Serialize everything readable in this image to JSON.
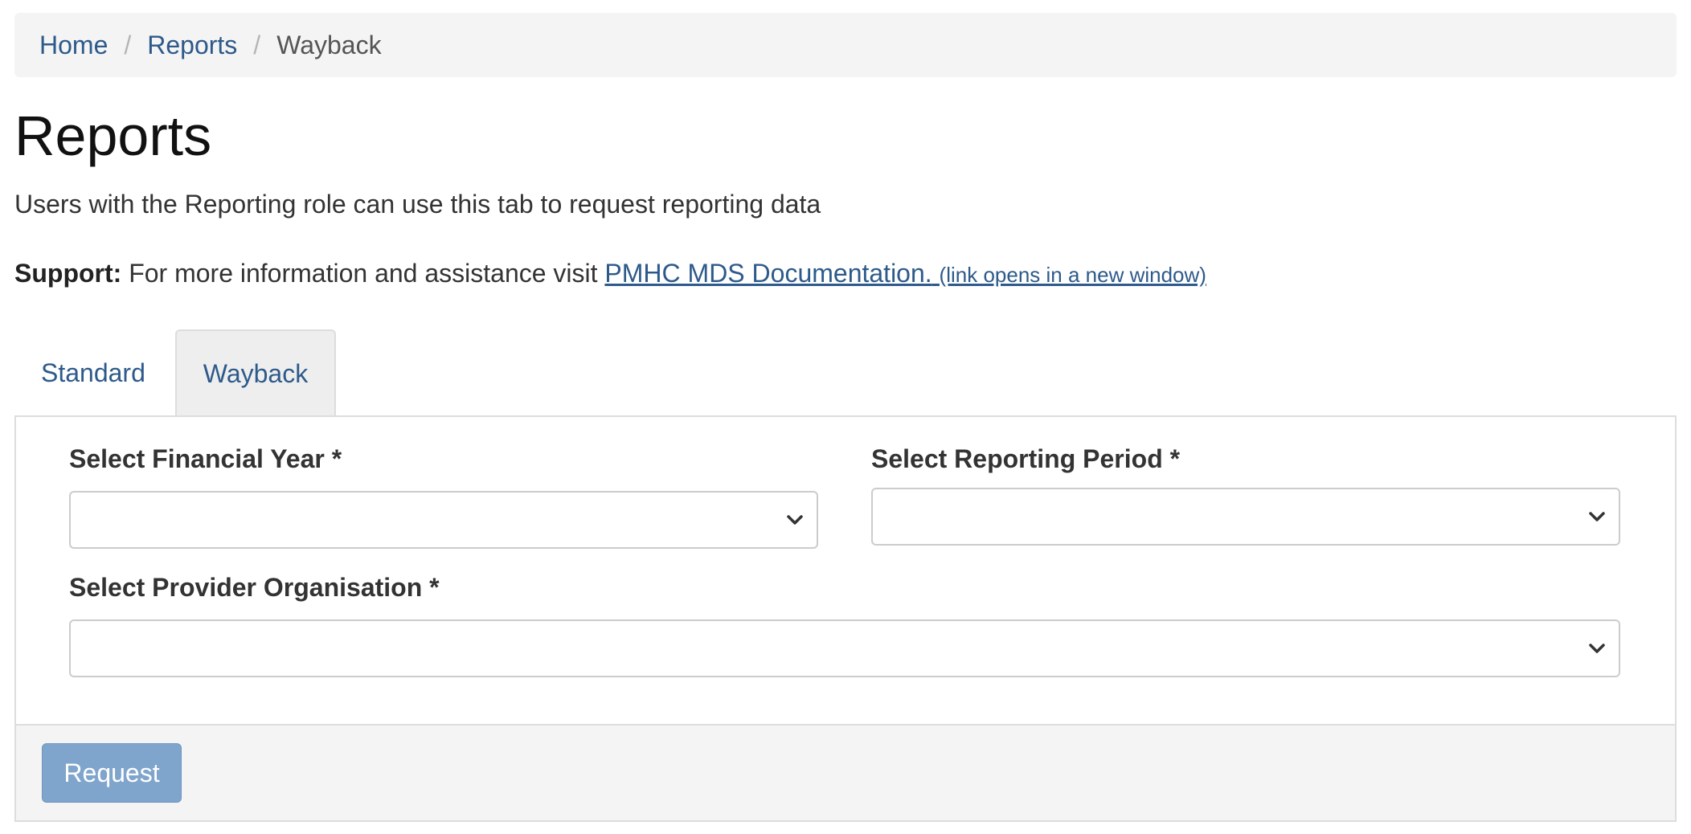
{
  "breadcrumb": {
    "items": [
      "Home",
      "Reports"
    ],
    "separator": "/",
    "current": "Wayback"
  },
  "page": {
    "title": "Reports",
    "subtitle": "Users with the Reporting role can use this tab to request reporting data"
  },
  "support": {
    "label": "Support:",
    "text": "For more information and assistance visit",
    "link_text": "PMHC MDS Documentation.",
    "link_note": "(link opens in a new window)"
  },
  "tabs": [
    {
      "label": "Standard",
      "active": false
    },
    {
      "label": "Wayback",
      "active": true
    }
  ],
  "form": {
    "financial_year": {
      "label": "Select Financial Year *",
      "value": ""
    },
    "reporting_period": {
      "label": "Select Reporting Period *",
      "value": ""
    },
    "provider_organisation": {
      "label": "Select Provider Organisation *",
      "value": ""
    },
    "submit_label": "Request"
  },
  "colors": {
    "link": "#2d5a8a",
    "button_bg": "#80a5cc",
    "panel_border": "#dddddd",
    "breadcrumb_bg": "#f4f4f4"
  },
  "icons": {
    "select_arrow": "chevron-down-icon"
  }
}
